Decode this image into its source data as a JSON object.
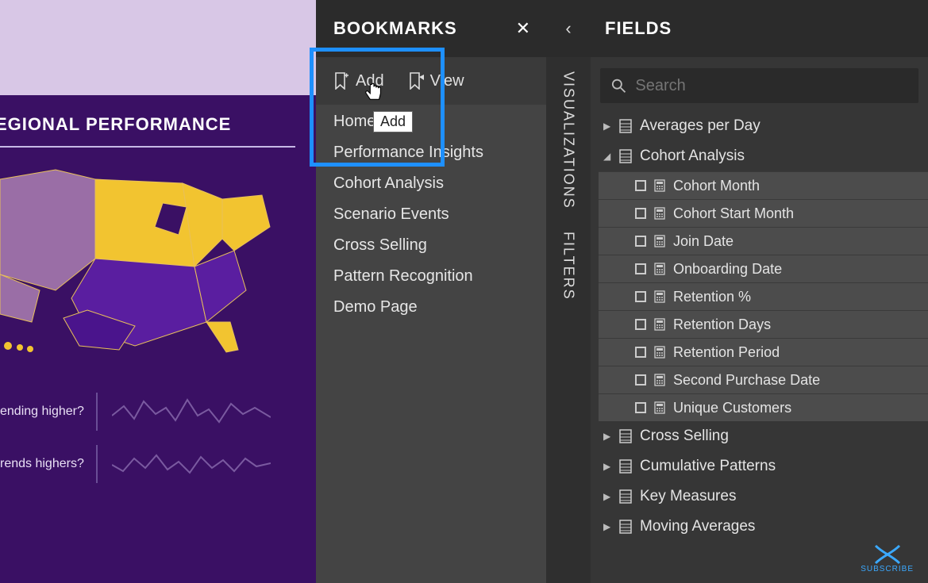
{
  "canvas": {
    "region_title": "EGIONAL PERFORMANCE",
    "question1": "ending higher?",
    "question2": "rends highers?"
  },
  "bookmarks": {
    "title": "BOOKMARKS",
    "add_label": "Add",
    "view_label": "View",
    "tooltip": "Add",
    "items": [
      "Home",
      "Performance Insights",
      "Cohort Analysis",
      "Scenario Events",
      "Cross Selling",
      "Pattern Recognition",
      "Demo Page"
    ]
  },
  "vstrip": {
    "visualizations": "VISUALIZATIONS",
    "filters": "FILTERS"
  },
  "fields": {
    "title": "FIELDS",
    "search_placeholder": "Search",
    "tables": [
      {
        "name": "Averages per Day",
        "expanded": false
      },
      {
        "name": "Cohort Analysis",
        "expanded": true,
        "fields": [
          "Cohort Month",
          "Cohort Start Month",
          "Join Date",
          "Onboarding Date",
          "Retention %",
          "Retention Days",
          "Retention Period",
          "Second Purchase Date",
          "Unique Customers"
        ]
      },
      {
        "name": "Cross Selling",
        "expanded": false
      },
      {
        "name": "Cumulative Patterns",
        "expanded": false
      },
      {
        "name": "Key Measures",
        "expanded": false
      },
      {
        "name": "Moving Averages",
        "expanded": false
      }
    ]
  },
  "subscribe_label": "SUBSCRIBE"
}
